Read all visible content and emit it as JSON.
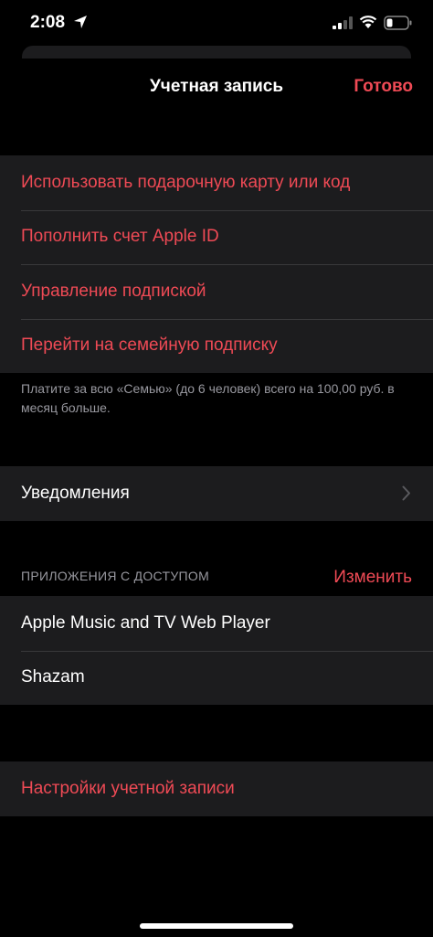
{
  "status_bar": {
    "time": "2:08",
    "icons": [
      "location-arrow-icon",
      "cellular-signal-icon",
      "wifi-icon",
      "battery-icon"
    ]
  },
  "nav": {
    "title": "Учетная запись",
    "done_label": "Готово"
  },
  "actions": [
    {
      "label": "Использовать подарочную карту или код"
    },
    {
      "label": "Пополнить счет Apple ID"
    },
    {
      "label": "Управление подпиской"
    },
    {
      "label": "Перейти на семейную подписку"
    }
  ],
  "family_note": "Платите за всю «Семью» (до 6 человек) всего на 100,00 руб. в месяц больше.",
  "notifications": {
    "label": "Уведомления"
  },
  "apps_section": {
    "header": "ПРИЛОЖЕНИЯ С ДОСТУПОМ",
    "edit_label": "Изменить",
    "items": [
      {
        "label": "Apple Music and TV Web Player"
      },
      {
        "label": "Shazam"
      }
    ]
  },
  "account_settings": {
    "label": "Настройки учетной записи"
  },
  "colors": {
    "accent": "#ef4a55",
    "background": "#000000",
    "cell": "#1c1c1e",
    "secondary_text": "#98989f"
  }
}
